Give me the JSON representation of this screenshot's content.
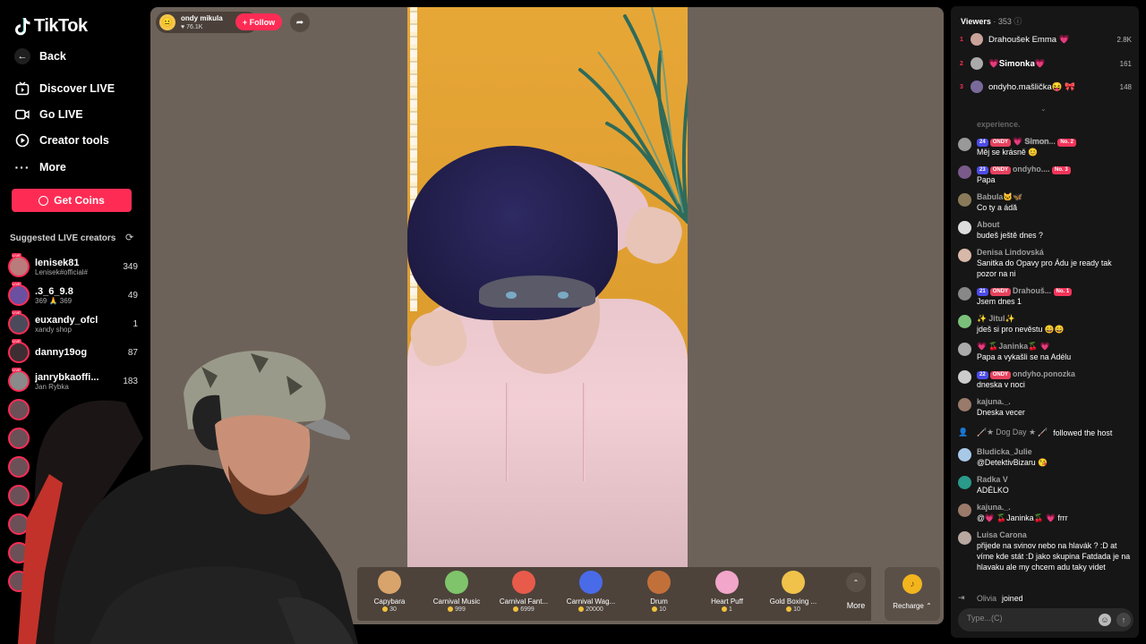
{
  "sidebar": {
    "logo": "TikTok",
    "back": "Back",
    "nav": [
      {
        "label": "Discover LIVE",
        "icon": "live-tv-icon"
      },
      {
        "label": "Go LIVE",
        "icon": "video-camera-icon"
      },
      {
        "label": "Creator tools",
        "icon": "play-square-icon"
      },
      {
        "label": "More",
        "icon": "ellipsis-icon"
      }
    ],
    "get_coins": "Get Coins",
    "suggested_title": "Suggested LIVE creators",
    "creators": [
      {
        "name": "lenisek81",
        "sub": "Lenisek#official#",
        "count": "349"
      },
      {
        "name": ".3_6_9.8",
        "sub": "369 🙏 369",
        "count": "49"
      },
      {
        "name": "euxandy_ofcl",
        "sub": "xandy shop",
        "count": "1"
      },
      {
        "name": "danny19og",
        "sub": "",
        "count": "87"
      },
      {
        "name": "janrybkaoffi...",
        "sub": "Jan Rybka",
        "count": "183"
      }
    ]
  },
  "stage": {
    "host_name": "ondy mikula",
    "host_likes": "76.1K",
    "follow": "+ Follow",
    "gifts": [
      {
        "name": "Capybara",
        "price": "30",
        "color": "#d9a46b"
      },
      {
        "name": "Carnival Music",
        "price": "999",
        "color": "#7fc46a"
      },
      {
        "name": "Carnival Fant...",
        "price": "6999",
        "color": "#e85a4a"
      },
      {
        "name": "Carnival Wag...",
        "price": "20000",
        "color": "#4a6be8"
      },
      {
        "name": "Drum",
        "price": "10",
        "color": "#c2703a"
      },
      {
        "name": "Heart Puff",
        "price": "1",
        "color": "#f2a6c9"
      },
      {
        "name": "Gold Boxing ...",
        "price": "10",
        "color": "#f0c24a"
      }
    ],
    "more": "More",
    "recharge": "Recharge"
  },
  "viewers": {
    "title": "Viewers",
    "count": "· 353",
    "top": [
      {
        "rank": "1",
        "name": "Drahoušek Emma 💗",
        "score": "2.8K"
      },
      {
        "rank": "2",
        "name": "💗𝐒𝐢𝐦𝐨𝐧𝐤𝐚💗",
        "score": "161"
      },
      {
        "rank": "3",
        "name": "ondyho.mašlička😝 🎀",
        "score": "148"
      }
    ]
  },
  "chat": {
    "faded": "experience.",
    "messages": [
      {
        "level": "24",
        "fan": "ONDY",
        "who": "💗 𝐒𝐢𝐦𝐨𝐧...",
        "no": "No. 2",
        "text": "Měj se krásně 😊"
      },
      {
        "level": "23",
        "fan": "ONDY",
        "who": "ondyho....",
        "no": "No. 3",
        "text": "Papa"
      },
      {
        "level": "",
        "fan": "",
        "who": "Babula🐱🦋",
        "no": "",
        "text": "Co ty a ádă"
      },
      {
        "level": "",
        "fan": "",
        "who": "About",
        "no": "",
        "text": "budeš ještě dnes ?"
      },
      {
        "level": "",
        "fan": "",
        "who": "Denisa Lindovská",
        "no": "",
        "text": "Sanitka do Opavy pro Ádu je ready tak pozor na ni"
      },
      {
        "level": "21",
        "fan": "ONDY",
        "who": "Drahouš...",
        "no": "No. 1",
        "text": "Jsem dnes 1"
      },
      {
        "level": "",
        "fan": "",
        "who": "✨ Jitul✨",
        "no": "",
        "text": "jdeš si pro nevěstu 😄😄"
      },
      {
        "level": "",
        "fan": "",
        "who": "💗 🍒Janinka🍒 💗",
        "no": "",
        "text": "Papa a vykašli se na Adélu"
      },
      {
        "level": "22",
        "fan": "ONDY",
        "who": "ondyho.ponozka",
        "no": "",
        "text": "dneska v noci"
      },
      {
        "level": "",
        "fan": "",
        "who": "kajuna._.",
        "no": "",
        "text": "Dneska vecer"
      }
    ],
    "follow_event": {
      "who": "🦯★ Dog Day ★ 🦯",
      "text": "followed the host"
    },
    "messages2": [
      {
        "who": "Bludicka_Julie",
        "text": "@DetektivBizaru 😘"
      },
      {
        "who": "Radka V",
        "text": "ADÉLKO"
      },
      {
        "who": "kajuna._.",
        "text": "@💗 🍒Janinka🍒 💗 frrr"
      },
      {
        "who": "Luisa Carona",
        "text": "přijede na svinov nebo na hlavák ? :D at víme kde stát :D jako skupina Fatdada je na hlavaku ale my chcem adu taky videt"
      }
    ],
    "join_event": {
      "who": "Olivia",
      "text": "joined"
    },
    "placeholder": "Type...(C)"
  },
  "colors": {
    "accent": "#fe2c55",
    "stage_bg": "#6d6259",
    "panel_bg": "#161616"
  }
}
